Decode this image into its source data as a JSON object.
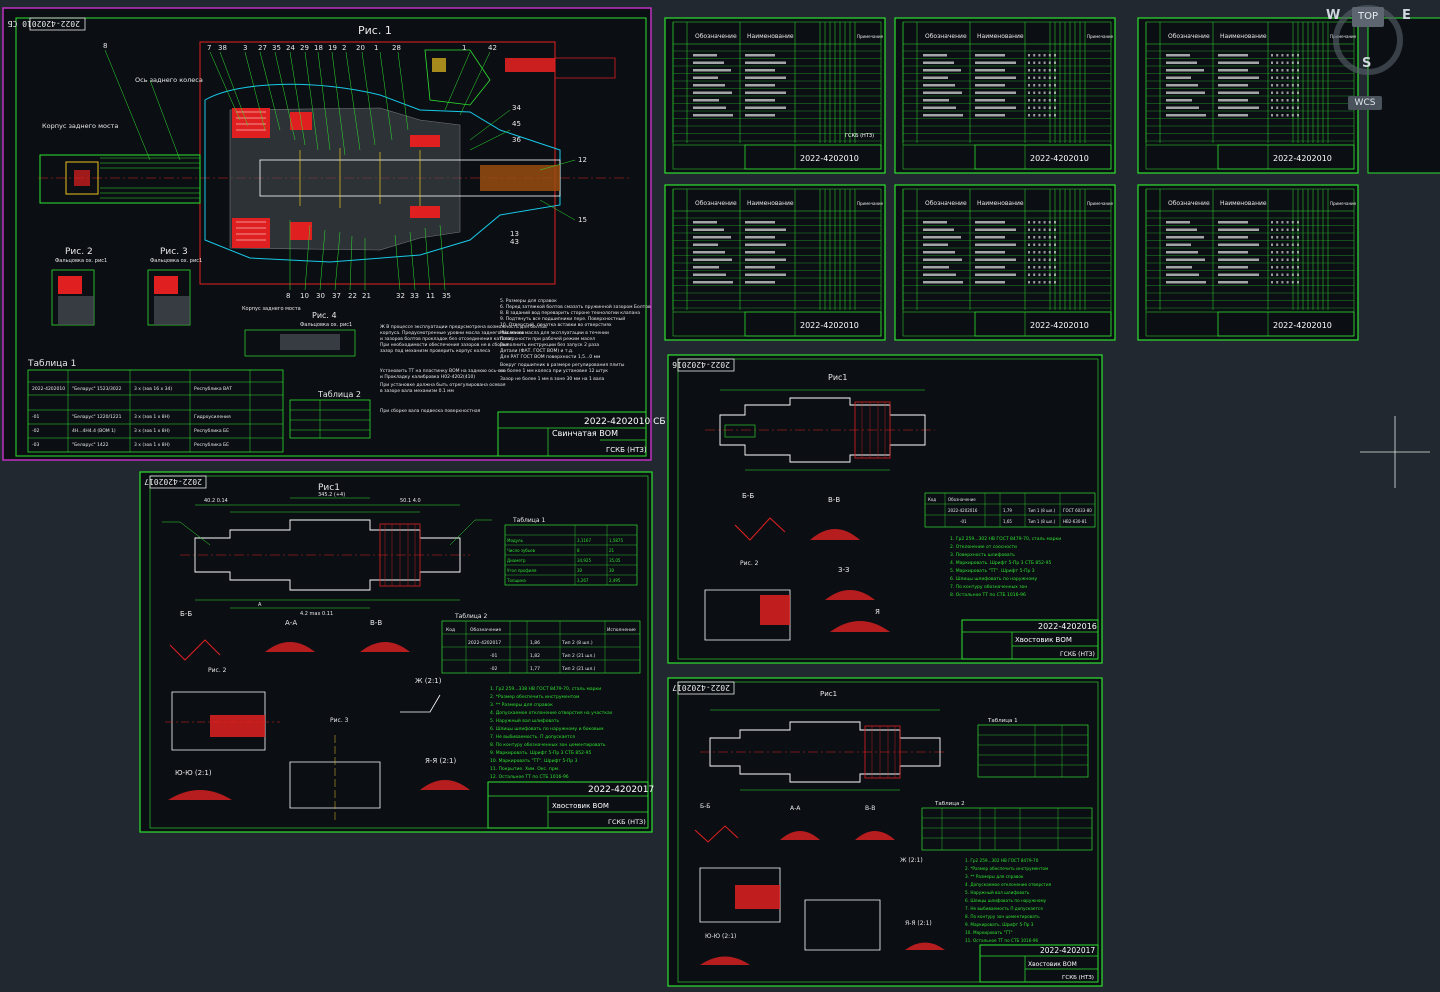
{
  "app": "AutoCAD drawing workspace",
  "viewcube": {
    "top": "TOP",
    "west": "W",
    "east": "E",
    "south": "S",
    "wcs": "WCS"
  },
  "crosshair": true,
  "assembly_sheet": {
    "stamp_number": "2022-4202010 СБ",
    "fig1": "Рис. 1",
    "fig2": "Рис. 2",
    "fig3": "Рис. 3",
    "fig4": "Рис. 4",
    "fig2_sub": "Фальцовка ох. рис1",
    "fig3_sub": "Фальцовка ох. рис1",
    "fig4_sub": "Фальцовка ох. рис1",
    "table1": "Таблица 1",
    "table2": "Таблица 2",
    "label_korpus": "Корпус заднего моста",
    "label_os": "Ось заднего колеса",
    "label_korpus2": "Корпус заднего моста",
    "title_name": "Свинчатая ВОМ",
    "title_org": "ГСКБ (НТЗ)"
  },
  "spec_sheets": [
    {
      "col1": "Обозначение",
      "col2": "Наименование",
      "col3": "Примечание",
      "stamp": "2022-4202010",
      "org": "ГСКБ (НТЗ)"
    },
    {
      "col1": "Обозначение",
      "col2": "Наименование",
      "col3": "Примечание",
      "stamp": "2022-4202010"
    },
    {
      "col1": "Обозначение",
      "col2": "Наименование",
      "col3": "Примечание",
      "stamp": "2022-4202010"
    },
    {
      "col1": "Обозначение",
      "col2": "Наименование",
      "col3": "Примечание",
      "stamp": "2022-4202010"
    },
    {
      "col1": "Обозначение",
      "col2": "Наименование",
      "col3": "Примечание",
      "stamp": "2022-4202010"
    },
    {
      "col1": "Обозначение",
      "col2": "Наименование",
      "col3": "Примечание",
      "stamp": "2022-4202010"
    }
  ],
  "part_sheets": [
    {
      "stamp": "2022-4202017",
      "fig": "Рис1",
      "title": "Хвостовик ВОМ",
      "org": "ГСКБ (НТЗ)",
      "table1": "Таблица 1",
      "table2": "Таблица 2",
      "sec_bb": "Б-Б",
      "sec_aa": "А-А",
      "sec_vv": "В-В",
      "sec_zh": "Ж (2:1)",
      "sec_ya": "Я-Я (2:1)",
      "sec_yu": "Ю-Ю (2:1)",
      "fig2": "Рис. 2",
      "fig3": "Рис. 3",
      "table2_code": "Код",
      "table2_oboz": "Обозначение",
      "table2_ispoln": "Исполнение"
    },
    {
      "stamp": "2022-4202016",
      "fig": "Рис1",
      "title": "Хвостовик ВОМ",
      "org": "ГСКБ (НТЗ)",
      "sec_bb": "Б-Б",
      "sec_vv": "В-В",
      "sec_zz": "З-З",
      "sec_ya": "Я",
      "fig2": "Рис. 2",
      "table_code": "Код",
      "table_oboz": "Обозначение"
    },
    {
      "stamp": "2022-4202017",
      "fig": "Рис1",
      "title": "Хвостовик ВОМ",
      "org": "ГСКБ (НТЗ)",
      "table1": "Таблица 1",
      "table2": "Таблица 2",
      "sec_bb": "Б-Б",
      "sec_aa": "А-А",
      "sec_vv": "В-В",
      "sec_zh": "Ж (2:1)",
      "sec_ya": "Я-Я (2:1)",
      "sec_yu": "Ю-Ю (2:1)"
    }
  ]
}
